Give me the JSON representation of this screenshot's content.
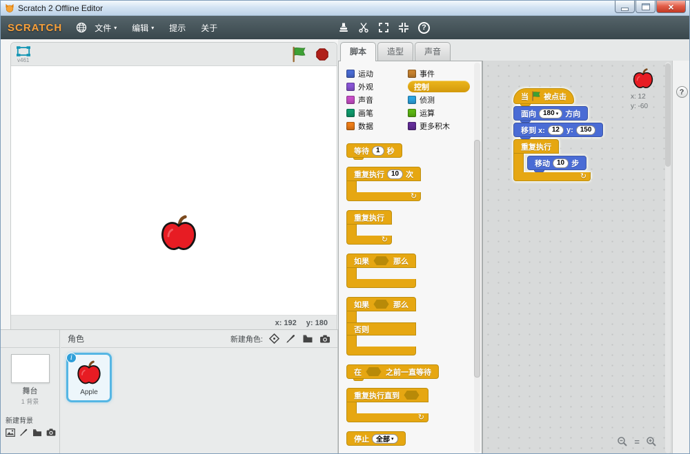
{
  "window": {
    "title": "Scratch 2 Offline Editor"
  },
  "menubar": {
    "logo": "SCRATCH",
    "items": [
      "文件",
      "编辑",
      "提示",
      "关于"
    ]
  },
  "stage": {
    "version": "v461",
    "mouse_x": "x: 192",
    "mouse_y": "y: 180"
  },
  "sprite_panel": {
    "header": "角色",
    "new_sprite_label": "新建角色:",
    "stage_thumb_title": "舞台",
    "stage_thumb_sub": "1 背景",
    "new_backdrop_label": "新建背景",
    "sprite_name": "Apple"
  },
  "tabs": [
    {
      "label": "脚本",
      "active": true
    },
    {
      "label": "造型",
      "active": false
    },
    {
      "label": "声音",
      "active": false
    }
  ],
  "categories": {
    "column1": [
      {
        "label": "运动",
        "color": "#4a6cd5"
      },
      {
        "label": "外观",
        "color": "#8a55d7"
      },
      {
        "label": "声音",
        "color": "#c94fc9"
      },
      {
        "label": "画笔",
        "color": "#0e9a6c"
      },
      {
        "label": "数据",
        "color": "#ee7d17"
      }
    ],
    "column2": [
      {
        "label": "事件",
        "color": "#c88330"
      },
      {
        "label": "控制",
        "color": "#e1a917",
        "selected": true
      },
      {
        "label": "侦测",
        "color": "#2ca5e2"
      },
      {
        "label": "运算",
        "color": "#5cb712"
      },
      {
        "label": "更多积木",
        "color": "#632d99"
      }
    ]
  },
  "palette": {
    "wait_pre": "等待",
    "wait_val": "1",
    "wait_post": "秒",
    "repeat_pre": "重复执行",
    "repeat_val": "10",
    "repeat_post": "次",
    "forever": "重复执行",
    "if_pre": "如果",
    "if_post": "那么",
    "else_label": "否则",
    "wait_until_pre": "在",
    "wait_until_post": "之前一直等待",
    "repeat_until": "重复执行直到",
    "stop_label": "停止",
    "stop_option": "全部"
  },
  "script": {
    "hat_pre": "当",
    "hat_post": "被点击",
    "point_pre": "面向",
    "point_val": "180",
    "point_post": "方向",
    "goto_pre": "移到 x:",
    "goto_x": "12",
    "goto_mid": "y:",
    "goto_y": "150",
    "forever": "重复执行",
    "move_pre": "移动",
    "move_val": "10",
    "move_post": "步"
  },
  "sprite_info": {
    "x": "x: 12",
    "y": "y: -60"
  },
  "zoom": {
    "reset_label": "="
  },
  "colors": {
    "control_block": "#e6a712",
    "motion_block": "#4a6cd5",
    "selected_sprite_border": "#55b6e4",
    "menubar": "#39474c",
    "logo_orange": "#f8a03a"
  }
}
